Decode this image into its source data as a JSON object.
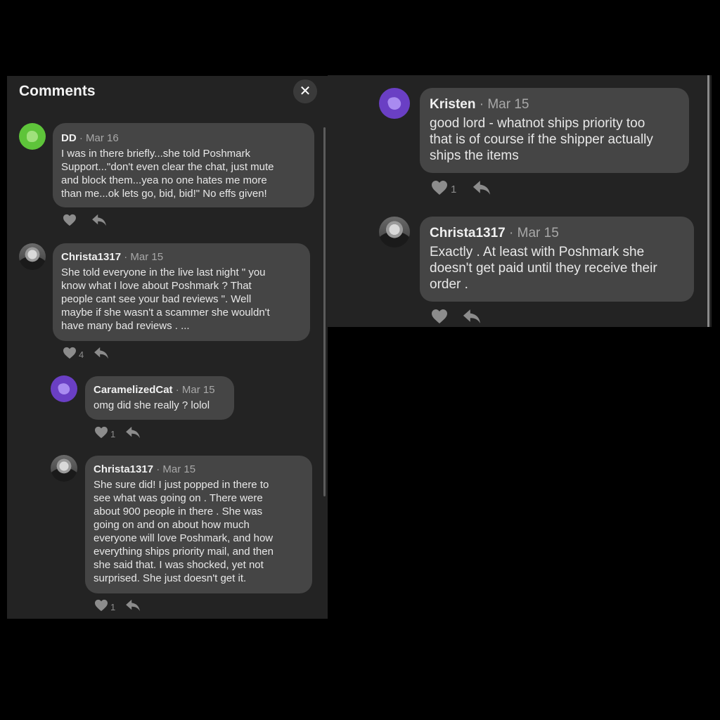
{
  "left": {
    "title": "Comments",
    "close_glyph": "✕",
    "comments": [
      {
        "user": "DD",
        "sep": "·",
        "date": "Mar 16",
        "avatar": "green-blob-avatar",
        "text": "I was in there briefly...she told Poshmark\nSupport...\"don't even clear the chat, just mute\nand block them...yea no one hates me more\nthan me...ok lets go, bid, bid!\" No effs given!",
        "likes": ""
      },
      {
        "user": "Christa1317",
        "sep": "·",
        "date": "Mar 15",
        "avatar": "profile-photo-avatar",
        "text": "She told everyone in the live last night \" you\nknow what I love about Poshmark ?  That\npeople cant see your bad reviews \".   Well\nmaybe if she wasn't a scammer she wouldn't\nhave many bad reviews . ...",
        "likes": "4"
      },
      {
        "user": "CaramelizedCat",
        "sep": "·",
        "date": "Mar 15",
        "avatar": "purple-blob-avatar",
        "text": "omg did she really ? lolol",
        "likes": "1"
      },
      {
        "user": "Christa1317",
        "sep": "·",
        "date": "Mar 15",
        "avatar": "profile-photo-avatar",
        "text": "She sure did! I just popped in there to\nsee what was going on . There were\nabout 900 people in there . She was\ngoing on and on about how much\neveryone will love Poshmark, and how\neverything ships priority mail, and then\nshe said that.   I was shocked, yet not\nsurprised. She just doesn't get it.",
        "likes": "1"
      }
    ]
  },
  "right": {
    "comments": [
      {
        "user": "Kristen",
        "sep": "·",
        "date": "Mar 15",
        "avatar": "purple-blob-avatar",
        "text": "good lord - whatnot ships priority too\nthat is of course if the shipper actually\nships the items",
        "likes": "1"
      },
      {
        "user": "Christa1317",
        "sep": "·",
        "date": "Mar 15",
        "avatar": "profile-photo-avatar",
        "text": "Exactly . At least with Poshmark she\ndoesn't get paid until they receive their\norder .",
        "likes": ""
      }
    ]
  },
  "icons": {
    "like": "heart-icon",
    "reply": "reply-arrow-icon"
  },
  "colors": {
    "panel": "#232323",
    "bubble": "#454545",
    "green_avatar": "#5ec43a",
    "purple_avatar": "#6a3fc4"
  }
}
